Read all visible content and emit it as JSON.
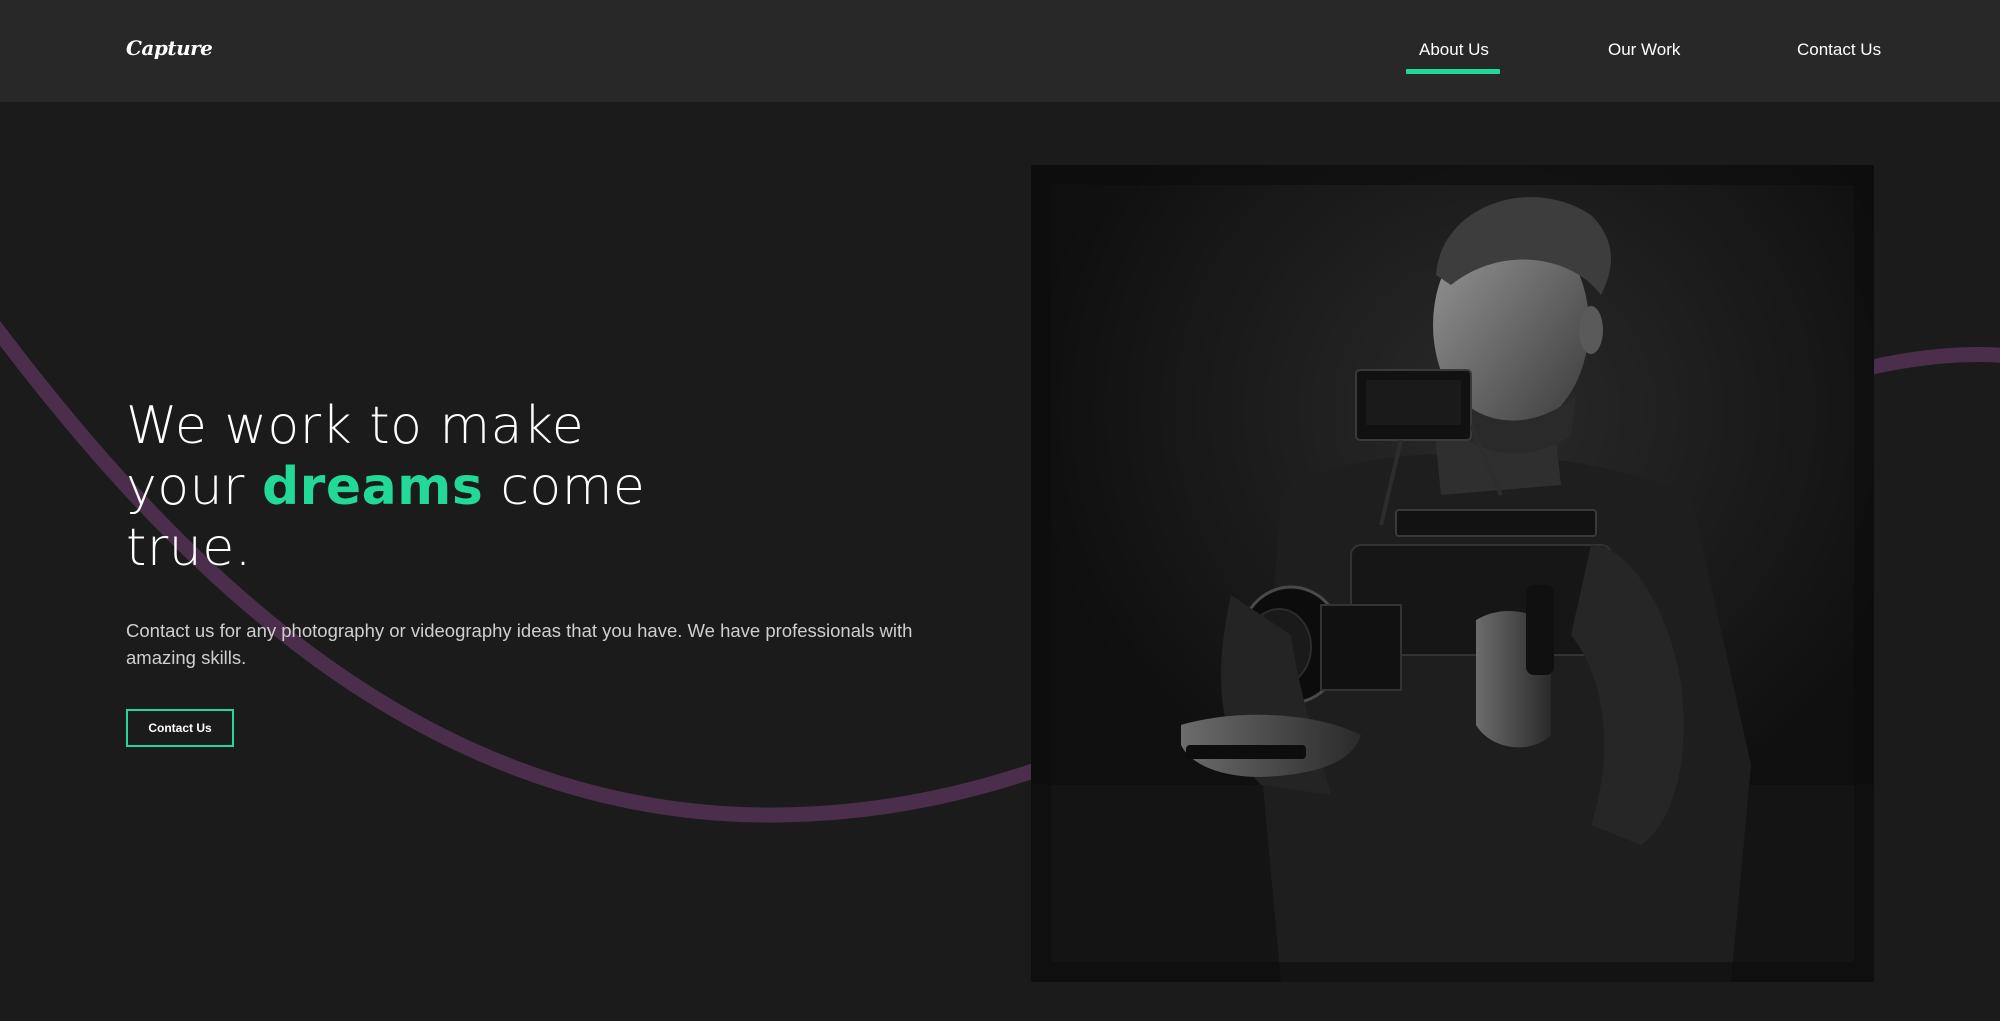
{
  "header": {
    "logo": "Capture",
    "nav": [
      {
        "label": "About Us",
        "active": true
      },
      {
        "label": "Our Work",
        "active": false
      },
      {
        "label": "Contact Us",
        "active": false
      }
    ]
  },
  "hero": {
    "headline_line1": "We work to make",
    "headline_line2_before": "your ",
    "headline_line2_accent": "dreams",
    "headline_line2_after": " come",
    "headline_line3": "true.",
    "description": "Contact us for any photography or videography ideas that you have. We have professionals with amazing skills.",
    "cta_label": "Contact Us"
  },
  "colors": {
    "accent": "#23d997",
    "curve": "#4b2e4c",
    "background": "#1b1b1b",
    "header_bg": "#282828"
  }
}
